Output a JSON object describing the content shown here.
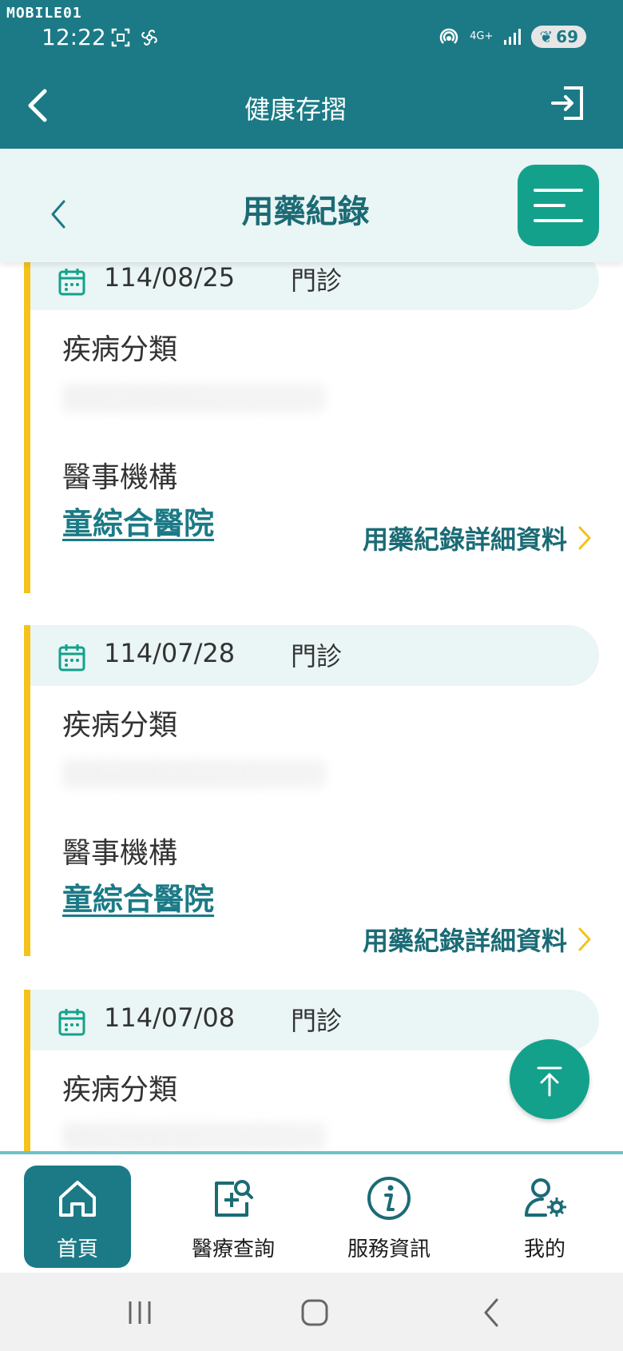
{
  "status_bar": {
    "watermark": "MOBILE01",
    "time": "12:22",
    "network": "4G+",
    "battery": "69"
  },
  "header": {
    "title": "健康存摺"
  },
  "subheader": {
    "title": "用藥紀錄"
  },
  "records": [
    {
      "date": "114/08/25",
      "visit_type": "門診",
      "disease_label": "疾病分類",
      "institution_label": "醫事機構",
      "institution_name": "童綜合醫院",
      "detail_link": "用藥紀錄詳細資料"
    },
    {
      "date": "114/07/28",
      "visit_type": "門診",
      "disease_label": "疾病分類",
      "institution_label": "醫事機構",
      "institution_name": "童綜合醫院",
      "detail_link": "用藥紀錄詳細資料"
    },
    {
      "date": "114/07/08",
      "visit_type": "門診",
      "disease_label": "疾病分類"
    }
  ],
  "bottom_nav": [
    {
      "label": "首頁",
      "icon": "home-icon",
      "active": true
    },
    {
      "label": "醫療查詢",
      "icon": "medical-search-icon",
      "active": false
    },
    {
      "label": "服務資訊",
      "icon": "info-icon",
      "active": false
    },
    {
      "label": "我的",
      "icon": "user-settings-icon",
      "active": false
    }
  ],
  "colors": {
    "primary": "#1b7a86",
    "accent": "#13a18b",
    "highlight": "#f4c21b",
    "panel": "#eaf5f5"
  }
}
